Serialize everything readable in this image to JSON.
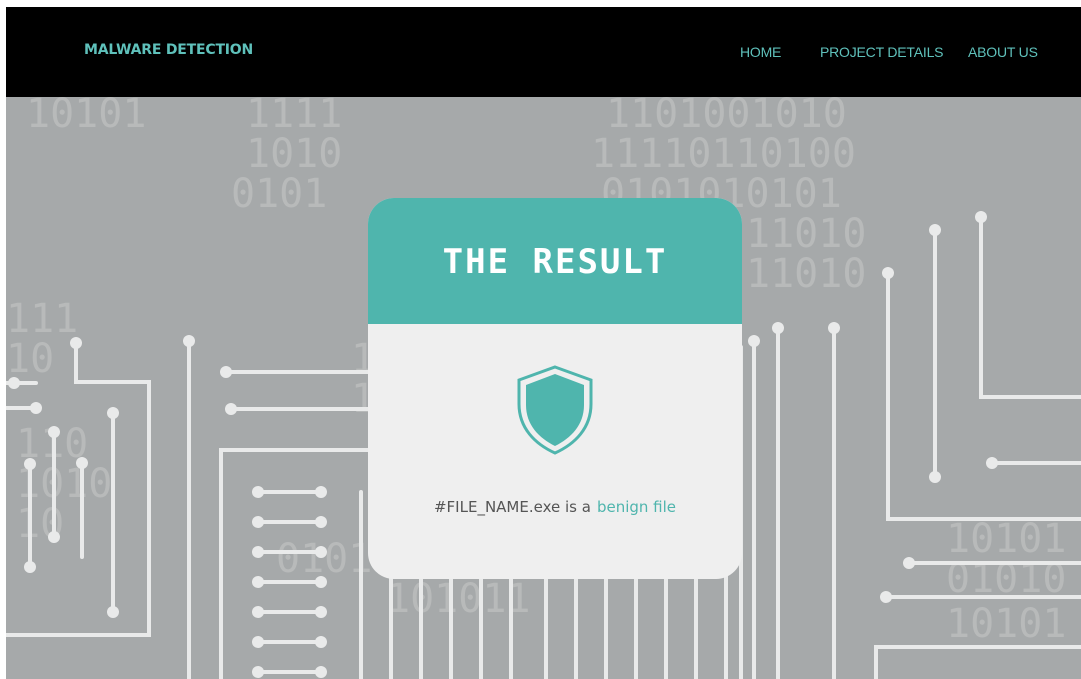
{
  "navbar": {
    "brand": "MALWARE DETECTION",
    "links": [
      "HOME",
      "PROJECT DETAILS",
      "ABOUT US"
    ]
  },
  "card": {
    "title": "THE RESULT",
    "icon": "shield-icon",
    "file_text": "#FILE_NAME.exe is a",
    "verdict": "benign file"
  },
  "colors": {
    "accent": "#4fb5ad",
    "navbar_bg": "#000000",
    "nav_text": "#5fc1bb",
    "background": "#a6a9aa",
    "card_bg": "#efefef"
  },
  "background_digits": [
    "10101",
    "1111",
    "1010",
    "0101",
    "1101001010",
    "11110110100",
    "0101010101",
    "11010",
    "11010",
    "111",
    "10",
    "1",
    "1",
    "110",
    "1010",
    "10",
    "0101",
    "101011",
    "10101",
    "01010",
    "10101"
  ]
}
